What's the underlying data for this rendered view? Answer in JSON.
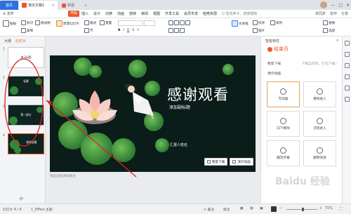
{
  "titlebar": {
    "home_tab": "首页",
    "doc_tab": "演示文稿1",
    "new_tab": "新建",
    "plus": "+",
    "window_controls": [
      "—",
      "□",
      "✕"
    ]
  },
  "menubar": {
    "file": "≡ 文件",
    "items": [
      "开始",
      "插入",
      "设计",
      "切换",
      "动画",
      "放映",
      "审阅",
      "视图",
      "开发工具",
      "会员专享",
      "稻壳资源"
    ],
    "active_index": 0,
    "search": "Q 查找命令、搜索模板",
    "right": [
      "未同步",
      "协作",
      "分享"
    ]
  },
  "ribbon": {
    "new_slide": "新建幻灯片",
    "layout": "版式",
    "section": "节",
    "reset": "重置",
    "paste": "粘贴",
    "format_painter": "格式刷",
    "cut": "剪切",
    "copy": "复制",
    "font_box": "",
    "text_box": "文本框",
    "shape": "形状",
    "arrange": "排列",
    "picture": "图片",
    "replace": "替换",
    "select": "选择"
  },
  "thumbpanel": {
    "tabs": [
      "大纲",
      "幻灯片"
    ],
    "slides": [
      {
        "num": "1",
        "text": "演示标题"
      },
      {
        "num": "2",
        "text": "标题"
      },
      {
        "num": "3",
        "text": "第一部分"
      },
      {
        "num": "4",
        "text": "感谢观看"
      }
    ],
    "add": "+"
  },
  "slide": {
    "title": "感谢观看",
    "subtitle": "添加副标题",
    "author": "汇报人姓名",
    "btn_unified": "整套下载",
    "btn_use": "演示动画"
  },
  "notes": "单击此处添加备注",
  "rightpanel": {
    "header": "智能特性",
    "close": "✕",
    "title": "结束页",
    "row1_left": "整套下载",
    "row1_right": "下载当前页，打包下载 ›",
    "section": "演示动画",
    "cards": [
      "无动画",
      "擦除进入",
      "向下擦除",
      "浮现进入",
      "翻页开幕",
      "翻转快速"
    ]
  },
  "statusbar": {
    "slide_info": "幻灯片 4 / 4",
    "theme": "1_Office 主题",
    "note_toggle": "≡ 备注",
    "comment": "批注",
    "zoom": "71%",
    "fit": "⛶"
  },
  "watermark": "Baidu 经验",
  "colors": {
    "accent": "#e85a2c",
    "home_blue": "#2f6fde",
    "slide_bg": "#0a1d19",
    "annotation_red": "#e02020"
  }
}
